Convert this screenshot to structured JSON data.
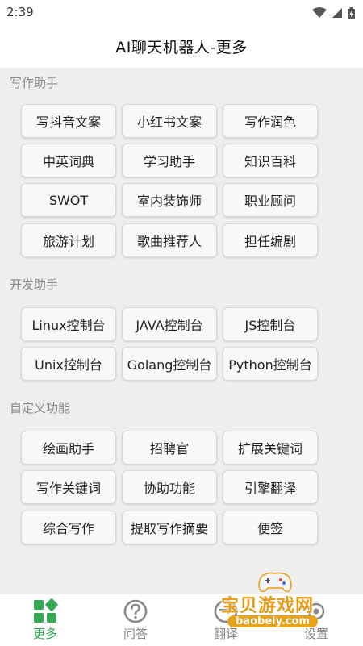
{
  "status": {
    "time": "2:39"
  },
  "header": {
    "title": "AI聊天机器人-更多"
  },
  "sections": [
    {
      "title": "写作助手",
      "buttons": [
        "写抖音文案",
        "小红书文案",
        "写作润色",
        "中英词典",
        "学习助手",
        "知识百科",
        "SWOT",
        "室内装饰师",
        "职业顾问",
        "旅游计划",
        "歌曲推荐人",
        "担任编剧"
      ]
    },
    {
      "title": "开发助手",
      "buttons": [
        "Linux控制台",
        "JAVA控制台",
        "JS控制台",
        "Unix控制台",
        "Golang控制台",
        "Python控制台"
      ]
    },
    {
      "title": "自定义功能",
      "buttons": [
        "绘画助手",
        "招聘官",
        "扩展关键词",
        "写作关键词",
        "协助功能",
        "引擎翻译",
        "综合写作",
        "提取写作摘要",
        "便签"
      ]
    }
  ],
  "nav": [
    {
      "label": "更多",
      "icon": "grid-icon",
      "active": true
    },
    {
      "label": "问答",
      "icon": "question-icon",
      "active": false
    },
    {
      "label": "翻译",
      "icon": "translate-icon",
      "active": false
    },
    {
      "label": "设置",
      "icon": "settings-icon",
      "active": false
    }
  ],
  "watermark": {
    "text": "宝贝游戏网",
    "url": "baobeiy.com"
  },
  "colors": {
    "accent": "#34a853",
    "background": "#eeeeee",
    "watermark": "#e89b15"
  }
}
